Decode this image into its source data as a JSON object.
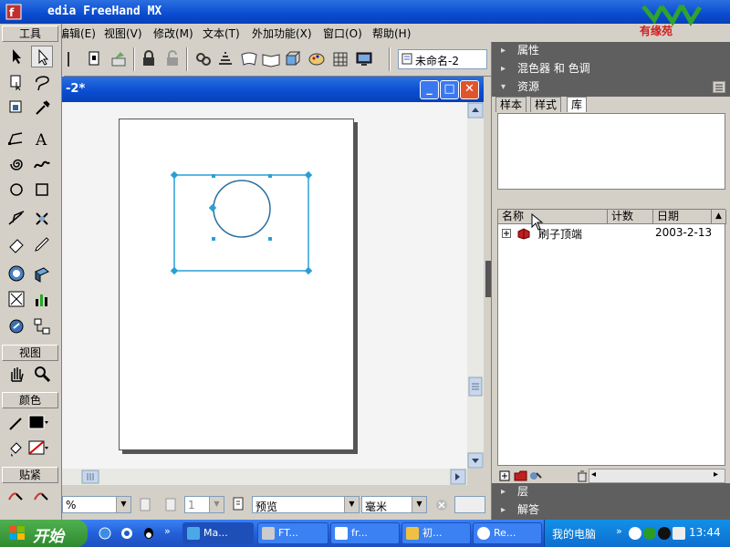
{
  "window": {
    "title": "edia FreeHand MX",
    "logo_text": "有缘苑"
  },
  "menubar": {
    "items": [
      {
        "label": "编辑(E)"
      },
      {
        "label": "视图(V)"
      },
      {
        "label": "修改(M)"
      },
      {
        "label": "文本(T)"
      },
      {
        "label": "外加功能(X)"
      },
      {
        "label": "窗口(O)"
      },
      {
        "label": "帮助(H)"
      }
    ]
  },
  "toolbar": {
    "document_selector": "未命名-2"
  },
  "tools_panel": {
    "title": "工具",
    "view_section": "视图",
    "color_section": "颜色",
    "snap_section": "贴紧"
  },
  "document": {
    "title": "-2*",
    "minimize": "_",
    "maximize": "□",
    "close": "✕"
  },
  "statusbar": {
    "zoom": "%",
    "page_number": "1",
    "view_mode": "预览",
    "units": "毫米"
  },
  "right_panels": {
    "properties": "属性",
    "mixer": "混色器 和 色调",
    "assets": "资源",
    "tabs": [
      "样本",
      "样式",
      "库"
    ],
    "library": {
      "columns": [
        "名称",
        "计数",
        "日期"
      ],
      "rows": [
        {
          "name": "刷子顶端",
          "count": "",
          "date": "2003-2-13"
        }
      ]
    },
    "layers": "层",
    "answers": "解答"
  },
  "taskbar": {
    "start": "开始",
    "tasks": [
      "Ma...",
      "FT...",
      "fr...",
      "初...",
      "Re..."
    ],
    "tray_label": "我的电脑",
    "clock": "13:44"
  },
  "colors": {
    "xp_blue": "#0a4cd0",
    "selection": "#2a9fd6",
    "panel_header": "#5f5f5f",
    "start_green": "#3a9a3a"
  }
}
